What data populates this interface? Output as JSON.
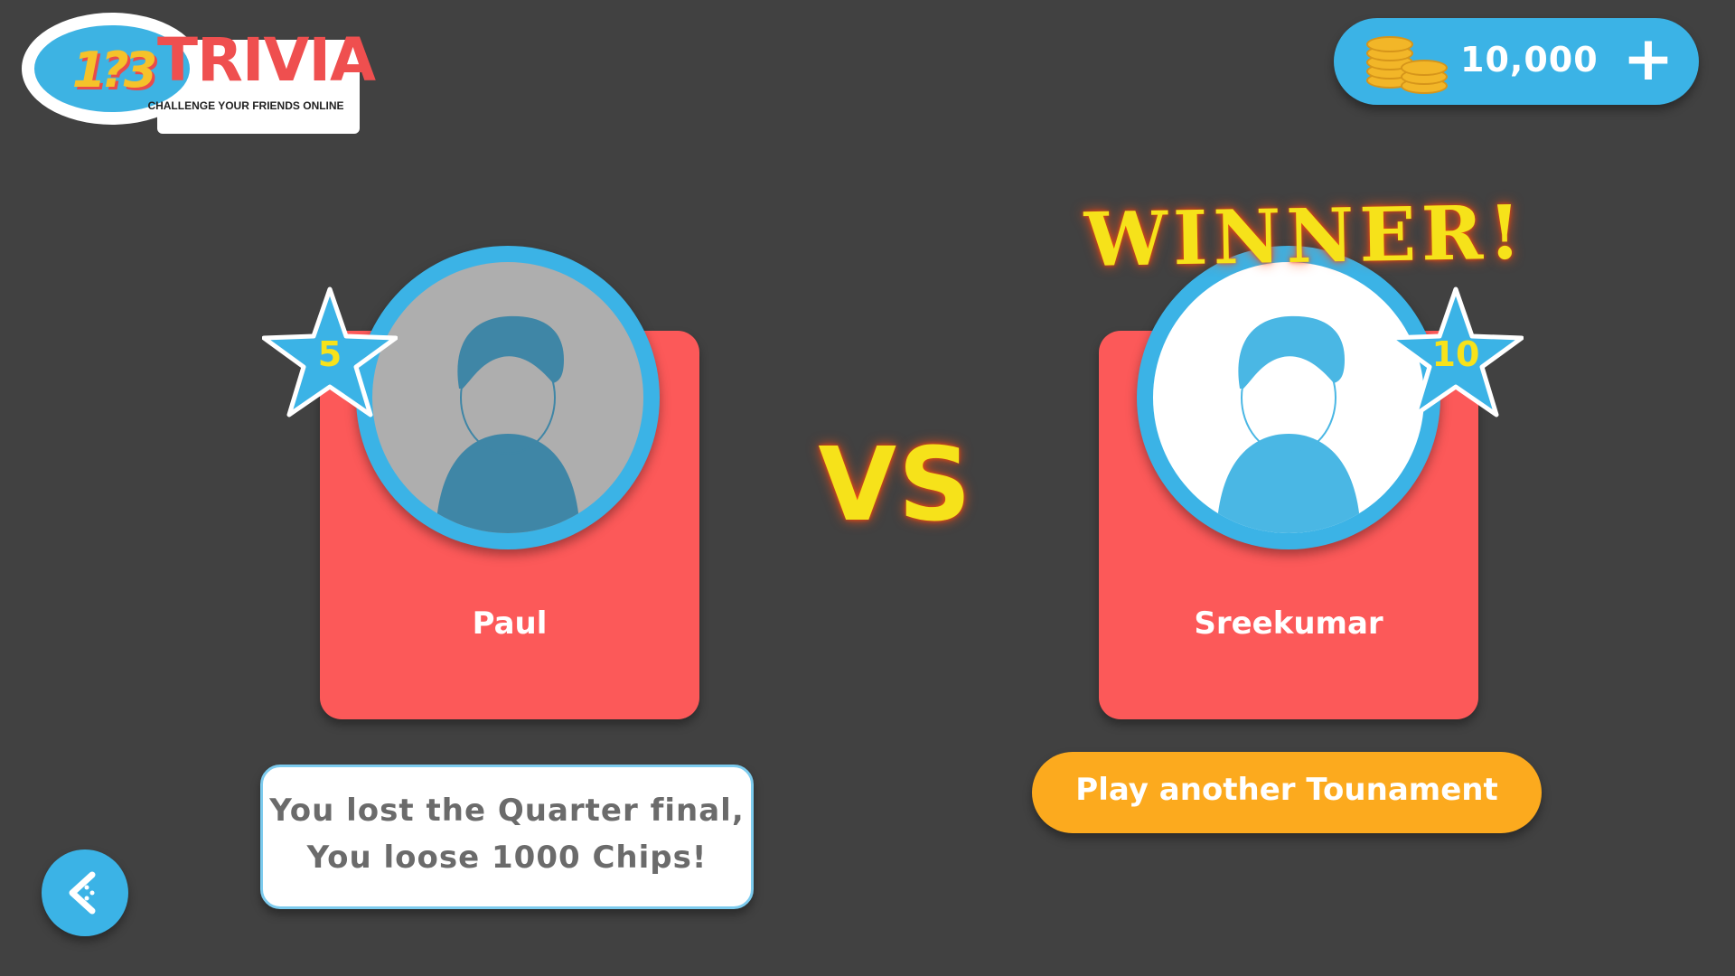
{
  "logo": {
    "numbers": "1?3",
    "title": "TRIVIA",
    "subtitle": "CHALLENGE YOUR FRIENDS ONLINE"
  },
  "wallet": {
    "coins": "10,000",
    "add_label": "+",
    "icon": "coin-stack-icon"
  },
  "players": {
    "left": {
      "name": "Paul",
      "level": "5"
    },
    "right": {
      "name": "Sreekumar",
      "level": "10"
    }
  },
  "versus_label": "VS",
  "winner_label": "WINNER!",
  "result": {
    "line1": "You lost the Quarter final,",
    "line2": "You loose 1000 Chips!"
  },
  "play_button": "Play another Tounament",
  "back_icon": "back-arrow-icon",
  "colors": {
    "background": "#414141",
    "card": "#fc5959",
    "accent_blue": "#3bb3e6",
    "button_orange": "#fcaa1e",
    "highlight_yellow": "#f6e21a"
  }
}
